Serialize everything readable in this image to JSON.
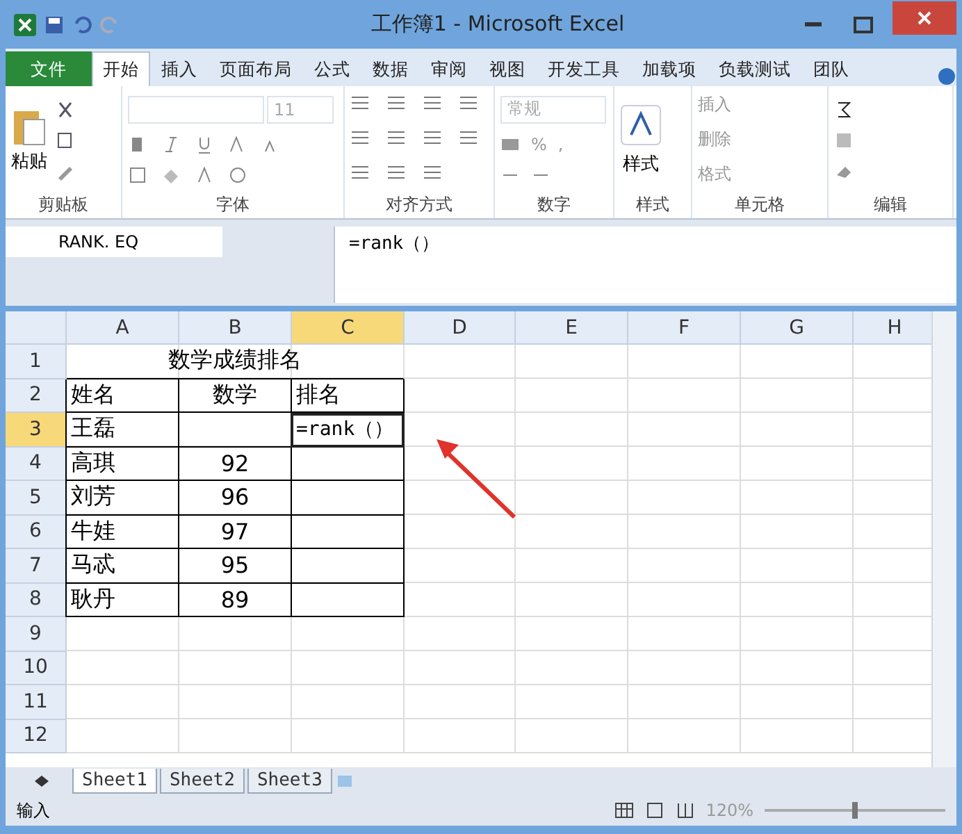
{
  "window": {
    "title": "工作簿1 - Microsoft Excel"
  },
  "ribbon_tabs": [
    {
      "label": "文件",
      "kind": "file",
      "selected": false
    },
    {
      "label": "开始",
      "kind": "tab",
      "selected": true
    },
    {
      "label": "插入",
      "kind": "tab",
      "selected": false
    },
    {
      "label": "页面布局",
      "kind": "tab",
      "selected": false
    },
    {
      "label": "公式",
      "kind": "tab",
      "selected": false
    },
    {
      "label": "数据",
      "kind": "tab",
      "selected": false
    },
    {
      "label": "审阅",
      "kind": "tab",
      "selected": false
    },
    {
      "label": "视图",
      "kind": "tab",
      "selected": false
    },
    {
      "label": "开发工具",
      "kind": "tab",
      "selected": false
    },
    {
      "label": "加载项",
      "kind": "tab",
      "selected": false
    },
    {
      "label": "负载测试",
      "kind": "tab",
      "selected": false
    },
    {
      "label": "团队",
      "kind": "tab",
      "selected": false
    }
  ],
  "ribbon": {
    "paste": "粘贴",
    "font_size": "11",
    "number_format": "常规",
    "percent": "%",
    "comma": ",",
    "styles": "样式",
    "insert": "插入",
    "delete": "删除",
    "format": "格式",
    "groups": [
      "剪贴板",
      "字体",
      "对齐方式",
      "数字",
      "样式",
      "单元格",
      "编辑"
    ]
  },
  "formula_bar": {
    "name_box": "RANK. EQ",
    "formula": "=rank（）"
  },
  "columns": [
    {
      "label": "A",
      "selected": false
    },
    {
      "label": "B",
      "selected": false
    },
    {
      "label": "C",
      "selected": true
    },
    {
      "label": "D",
      "selected": false
    },
    {
      "label": "E",
      "selected": false
    },
    {
      "label": "F",
      "selected": false
    },
    {
      "label": "G",
      "selected": false
    },
    {
      "label": "H",
      "selected": false
    }
  ],
  "rows": [
    {
      "number": "1",
      "selected": false,
      "cells": [
        {
          "text": "数学成绩排名",
          "kind": "merged",
          "selected": false
        }
      ]
    },
    {
      "number": "2",
      "selected": false,
      "cells": [
        {
          "text": "姓名",
          "selected": false
        },
        {
          "text": "数学",
          "selected": false
        },
        {
          "text": "排名",
          "selected": false
        }
      ]
    },
    {
      "number": "3",
      "selected": true,
      "cells": [
        {
          "text": "王磊",
          "selected": false
        },
        {
          "text": "",
          "selected": false
        },
        {
          "text": "=rank（）",
          "selected": true
        }
      ]
    },
    {
      "number": "4",
      "selected": false,
      "cells": [
        {
          "text": "高琪",
          "selected": false
        },
        {
          "text": "92",
          "selected": false
        },
        {
          "text": "",
          "selected": false
        }
      ]
    },
    {
      "number": "5",
      "selected": false,
      "cells": [
        {
          "text": "刘芳",
          "selected": false
        },
        {
          "text": "96",
          "selected": false
        },
        {
          "text": "",
          "selected": false
        }
      ]
    },
    {
      "number": "6",
      "selected": false,
      "cells": [
        {
          "text": "牛娃",
          "selected": false
        },
        {
          "text": "97",
          "selected": false
        },
        {
          "text": "",
          "selected": false
        }
      ]
    },
    {
      "number": "7",
      "selected": false,
      "cells": [
        {
          "text": "马忒",
          "selected": false
        },
        {
          "text": "95",
          "selected": false
        },
        {
          "text": "",
          "selected": false
        }
      ]
    },
    {
      "number": "8",
      "selected": false,
      "cells": [
        {
          "text": "耿丹",
          "selected": false
        },
        {
          "text": "89",
          "selected": false
        },
        {
          "text": "",
          "selected": false
        }
      ]
    },
    {
      "number": "9",
      "selected": false,
      "cells": []
    },
    {
      "number": "10",
      "selected": false,
      "cells": []
    },
    {
      "number": "11",
      "selected": false,
      "cells": []
    },
    {
      "number": "12",
      "selected": false,
      "cells": []
    }
  ],
  "sheet_tabs": [
    {
      "label": "Sheet1",
      "selected": true
    },
    {
      "label": "Sheet2",
      "selected": false
    },
    {
      "label": "Sheet3",
      "selected": false
    }
  ],
  "status_bar": {
    "mode": "输入",
    "zoom": "120%",
    "level": 0.5
  }
}
